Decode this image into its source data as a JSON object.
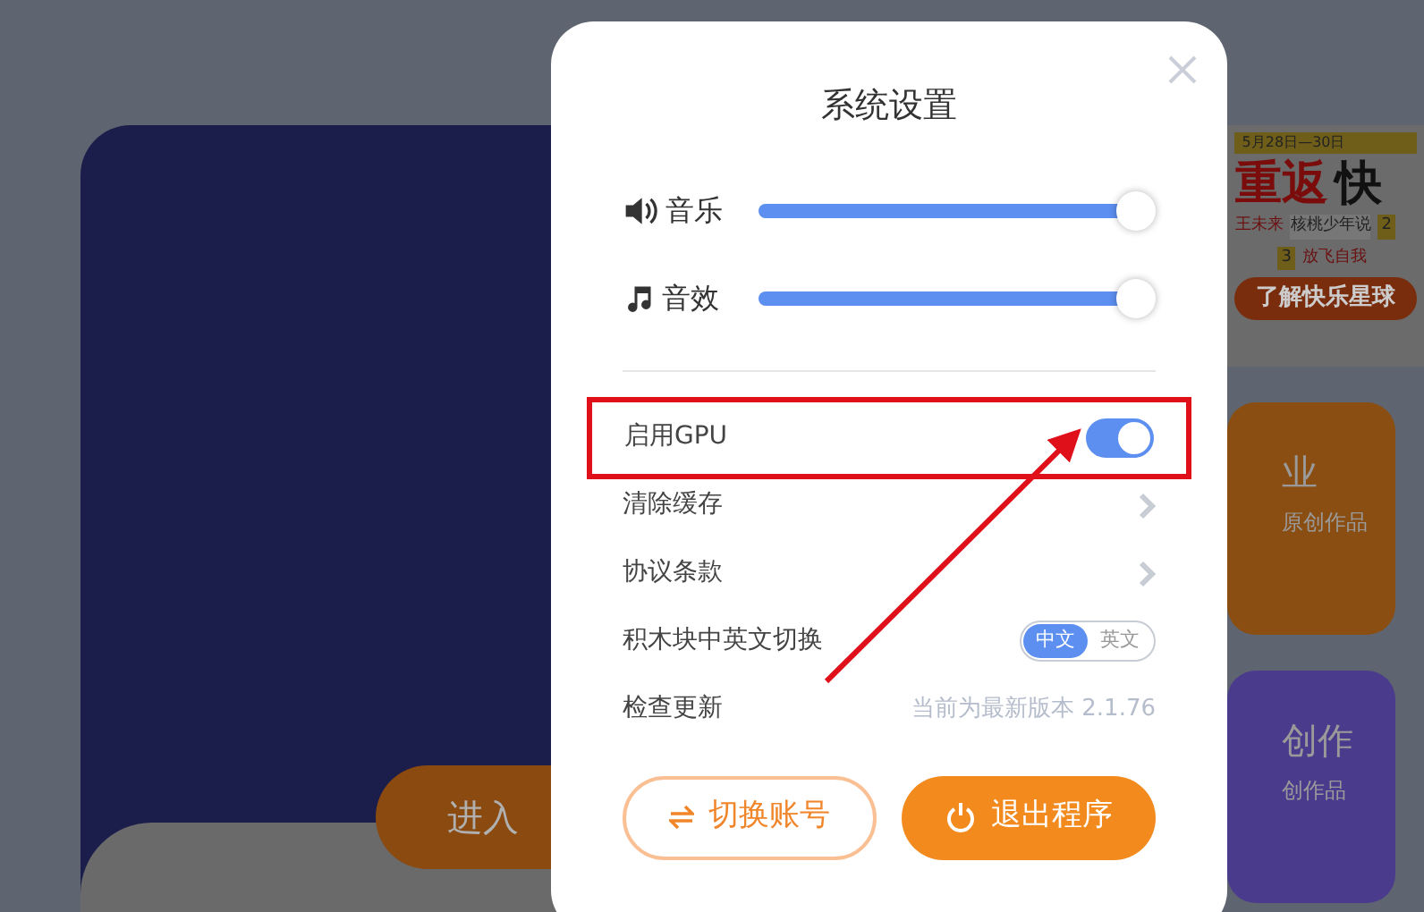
{
  "background": {
    "banner": {
      "date": "5月28日—30日",
      "headline": "重返",
      "headline_cut": "快",
      "tags": [
        "王未来",
        "核桃少年说",
        "放飞自我"
      ],
      "numbers": [
        "2",
        "3"
      ],
      "link": "了解快乐星球"
    },
    "enter_button": "进入",
    "cards": [
      {
        "title": "业",
        "subtitle": "原创作品",
        "color": "#8a4e12"
      },
      {
        "title": "创作",
        "subtitle": "创作品",
        "color": "#4b3b8c"
      }
    ]
  },
  "dialog": {
    "title": "系统设置",
    "volumes": [
      {
        "kind": "music",
        "label": "音乐",
        "level": 1
      },
      {
        "kind": "effects",
        "label": "音效",
        "level": 1
      }
    ],
    "settings": [
      {
        "kind": "toggle",
        "label": "启用GPU",
        "on": true,
        "highlighted": true
      },
      {
        "kind": "link",
        "label": "清除缓存"
      },
      {
        "kind": "link",
        "label": "协议条款"
      },
      {
        "kind": "segmented",
        "label": "积木块中英文切换",
        "options": [
          {
            "label": "中文",
            "selected": true
          },
          {
            "label": "英文",
            "selected": false
          }
        ]
      },
      {
        "kind": "info",
        "label": "检查更新",
        "value": "当前为最新版本 2.1.76"
      }
    ],
    "buttons": [
      {
        "kind": "outline",
        "label": "切换账号"
      },
      {
        "kind": "solid",
        "label": "退出程序"
      }
    ]
  }
}
